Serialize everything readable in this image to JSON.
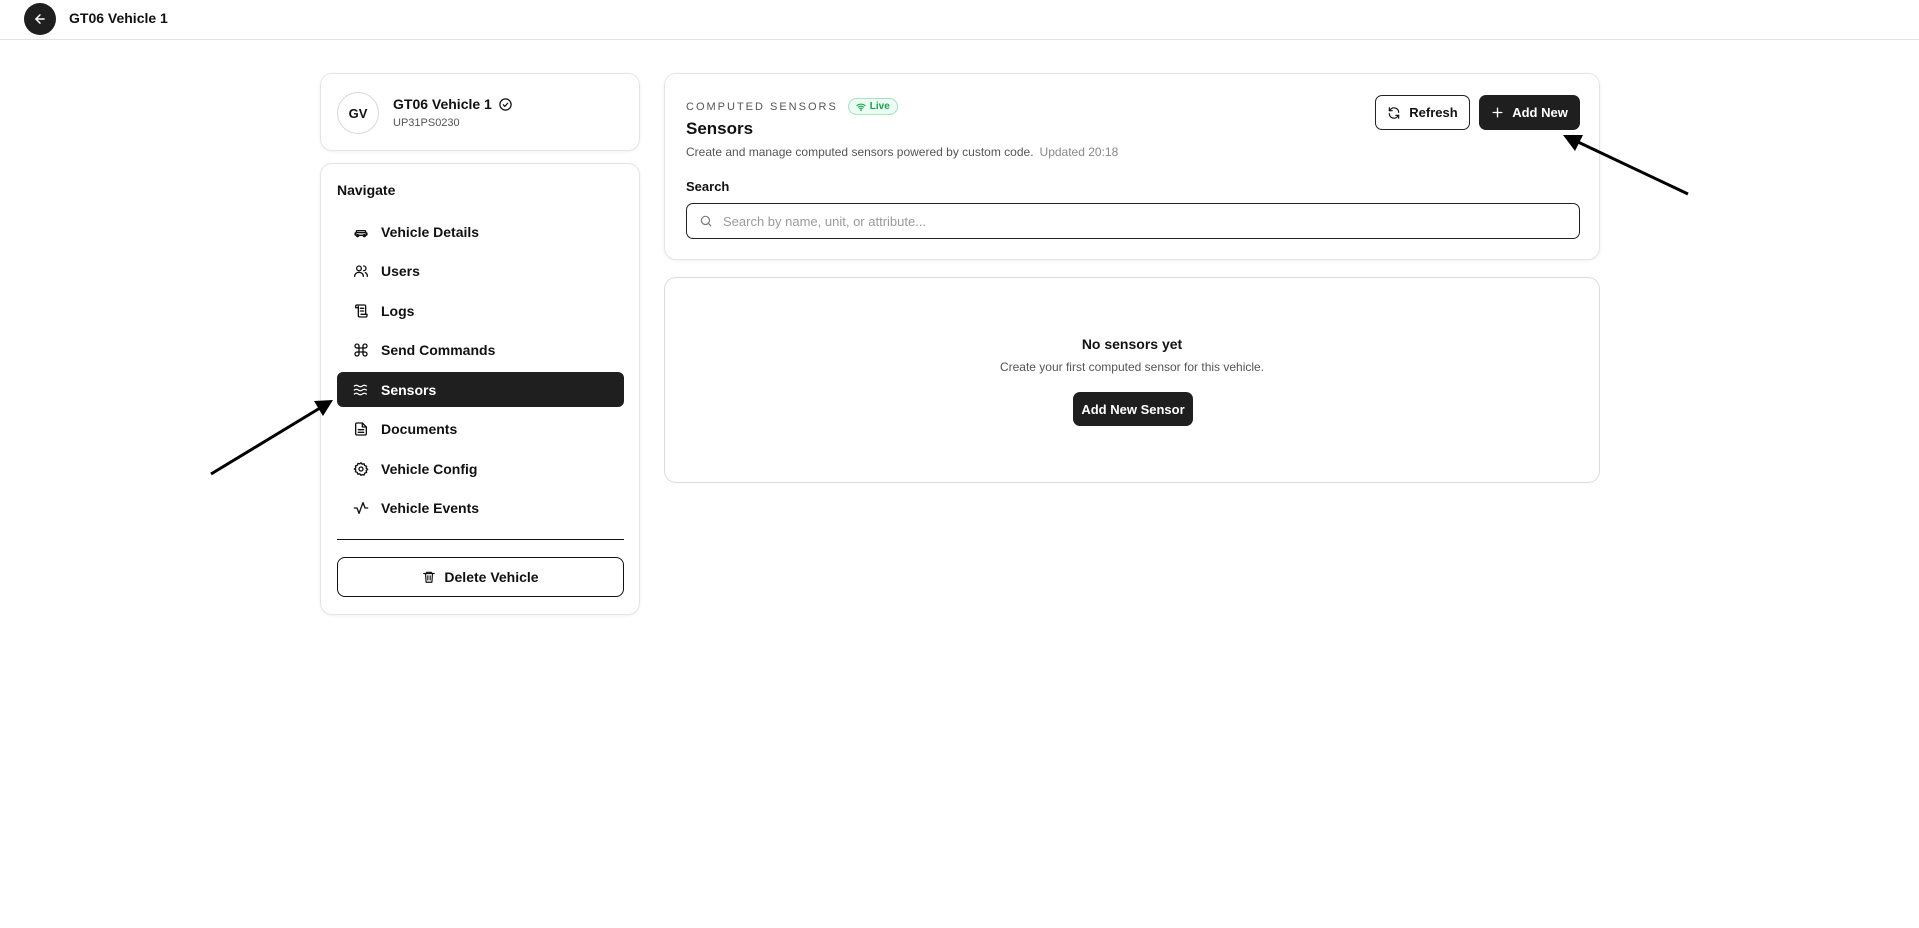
{
  "header": {
    "title": "GT06 Vehicle 1"
  },
  "vehicle": {
    "initials": "GV",
    "name": "GT06 Vehicle 1",
    "plate": "UP31PS0230"
  },
  "nav": {
    "heading": "Navigate",
    "items": [
      {
        "label": "Vehicle Details",
        "icon": "car-icon",
        "active": false
      },
      {
        "label": "Users",
        "icon": "users-icon",
        "active": false
      },
      {
        "label": "Logs",
        "icon": "scroll-icon",
        "active": false
      },
      {
        "label": "Send Commands",
        "icon": "command-icon",
        "active": false
      },
      {
        "label": "Sensors",
        "icon": "waves-icon",
        "active": true
      },
      {
        "label": "Documents",
        "icon": "document-icon",
        "active": false
      },
      {
        "label": "Vehicle Config",
        "icon": "gear-icon",
        "active": false
      },
      {
        "label": "Vehicle Events",
        "icon": "activity-icon",
        "active": false
      }
    ],
    "delete_label": "Delete Vehicle"
  },
  "sensors": {
    "eyebrow": "COMPUTED SENSORS",
    "live_badge": "Live",
    "title": "Sensors",
    "description": "Create and manage computed sensors powered by custom code.",
    "updated": "Updated 20:18",
    "refresh_label": "Refresh",
    "add_new_label": "Add New",
    "search_label": "Search",
    "search_placeholder": "Search by name, unit, or attribute..."
  },
  "empty_state": {
    "title": "No sensors yet",
    "description": "Create your first computed sensor for this vehicle.",
    "button_label": "Add New Sensor"
  },
  "colors": {
    "dark": "#1f1f1f",
    "live_green": "#16a34a",
    "live_bg": "#ecfdf3"
  }
}
